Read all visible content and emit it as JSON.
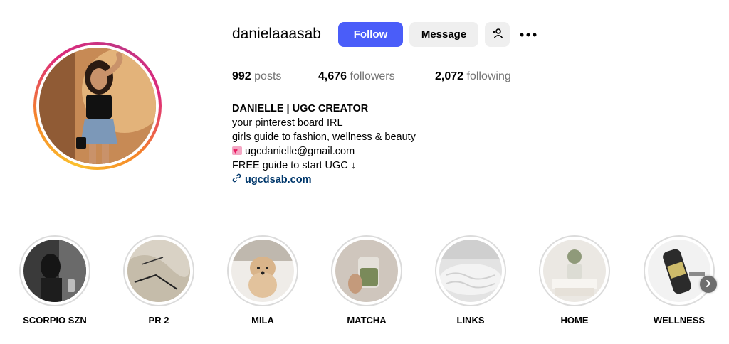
{
  "profile": {
    "username": "danielaaasab",
    "follow_label": "Follow",
    "message_label": "Message",
    "suggest_icon": "add-person-icon",
    "more_icon": "more-options-icon"
  },
  "stats": {
    "posts_count": "992",
    "posts_label": "posts",
    "followers_count": "4,676",
    "followers_label": "followers",
    "following_count": "2,072",
    "following_label": "following"
  },
  "bio": {
    "name": "DANIELLE | UGC CREATOR",
    "line1": "your pinterest board IRL",
    "line2": "girls guide to fashion, wellness & beauty",
    "email": "ugcdanielle@gmail.com",
    "line4": "FREE guide to start UGC ↓",
    "link": "ugcdsab.com"
  },
  "highlights": [
    {
      "label": "SCORPIO SZN"
    },
    {
      "label": "PR 2"
    },
    {
      "label": "MILA"
    },
    {
      "label": "MATCHA"
    },
    {
      "label": "LINKS"
    },
    {
      "label": "HOME"
    },
    {
      "label": "WELLNESS"
    }
  ],
  "colors": {
    "accent": "#4a5df9",
    "link": "#00376b",
    "muted": "#737373"
  }
}
